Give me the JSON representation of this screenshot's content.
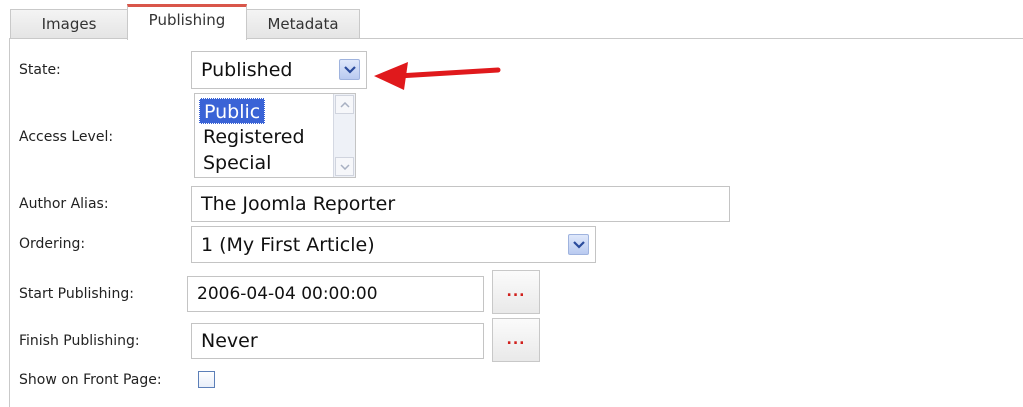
{
  "tabs": [
    {
      "label": "Images"
    },
    {
      "label": "Publishing",
      "active": true
    },
    {
      "label": "Metadata"
    }
  ],
  "form": {
    "state": {
      "label": "State:",
      "value": "Published"
    },
    "access_level": {
      "label": "Access Level:",
      "options": [
        "Public",
        "Registered",
        "Special"
      ],
      "selected": "Public"
    },
    "author_alias": {
      "label": "Author Alias:",
      "value": "The Joomla Reporter"
    },
    "ordering": {
      "label": "Ordering:",
      "value": "1 (My First Article)"
    },
    "start_publishing": {
      "label": "Start Publishing:",
      "value": "2006-04-04 00:00:00",
      "button": "..."
    },
    "finish_publishing": {
      "label": "Finish Publishing:",
      "value": "Never",
      "button": "..."
    },
    "show_on_front_page": {
      "label": "Show on Front Page:",
      "checked": false
    }
  },
  "colors": {
    "annotation_arrow": "#e0191c",
    "active_tab_accent": "#d9564a",
    "selection": "#3a63d6"
  },
  "icons": {
    "dropdown": "chevron-down-icon",
    "scroll_up": "chevron-up-icon",
    "scroll_down": "chevron-down-icon",
    "annotation": "red-arrow-icon"
  }
}
